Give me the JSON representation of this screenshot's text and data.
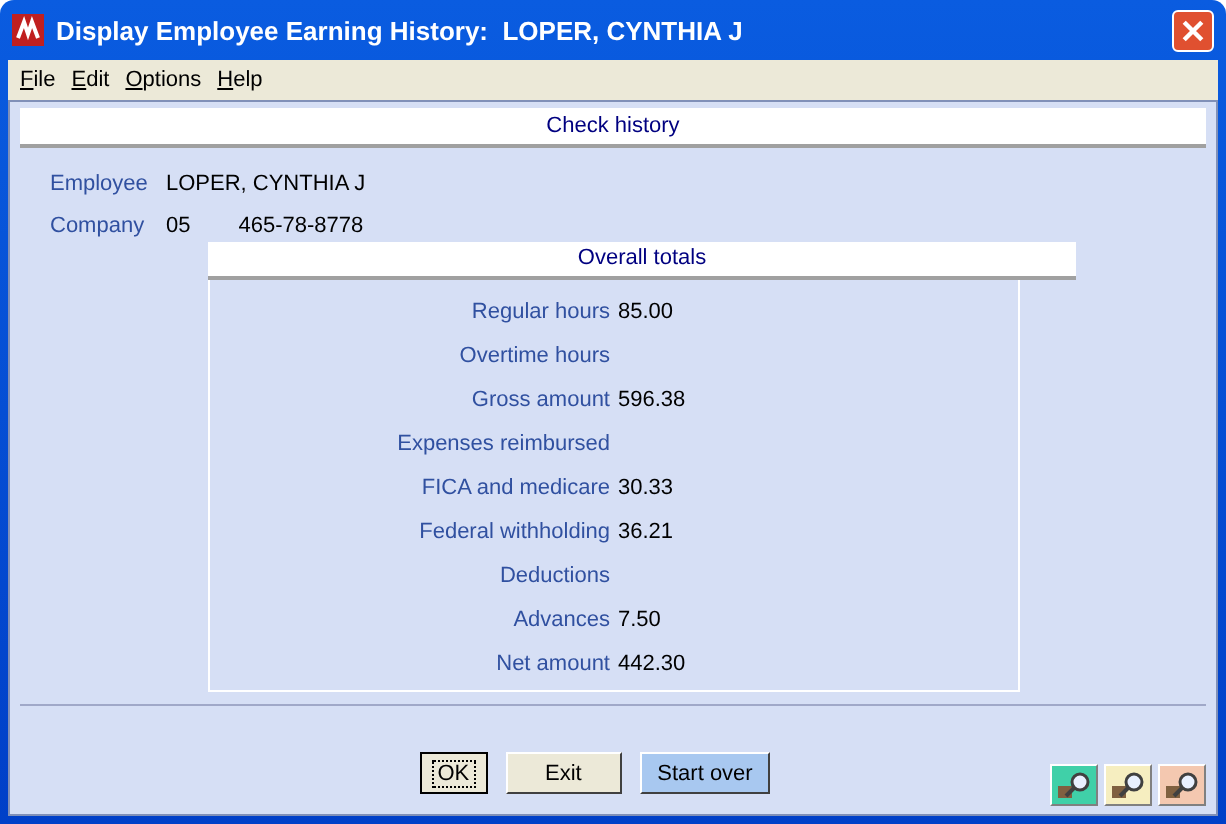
{
  "window": {
    "title": "Display Employee Earning History:  LOPER, CYNTHIA J"
  },
  "menu": [
    "File",
    "Edit",
    "Options",
    "Help"
  ],
  "section_title": "Check history",
  "fields": [
    {
      "label": "Employee",
      "values": [
        "LOPER, CYNTHIA J"
      ]
    },
    {
      "label": "Company",
      "values": [
        "05",
        "465-78-8778"
      ]
    }
  ],
  "totals": {
    "title": "Overall totals",
    "rows": [
      {
        "label": "Regular hours",
        "value": "85.00"
      },
      {
        "label": "Overtime hours"
      },
      {
        "label": "Gross amount",
        "value": "596.38"
      },
      {
        "label": "Expenses reimbursed"
      },
      {
        "label": "FICA and medicare",
        "value": "30.33"
      },
      {
        "label": "Federal withholding",
        "value": "36.21"
      },
      {
        "label": "Deductions"
      },
      {
        "label": "Advances",
        "value": "7.50"
      },
      {
        "label": "Net amount",
        "value": "442.30"
      }
    ]
  },
  "buttons": [
    {
      "label": "OK",
      "kind": "focused"
    },
    {
      "label": "Exit",
      "kind": "plain"
    },
    {
      "label": "Start over",
      "kind": "highlight"
    }
  ],
  "tools": [
    {
      "kind": "green"
    },
    {
      "kind": "yellow"
    },
    {
      "kind": "pink"
    }
  ]
}
